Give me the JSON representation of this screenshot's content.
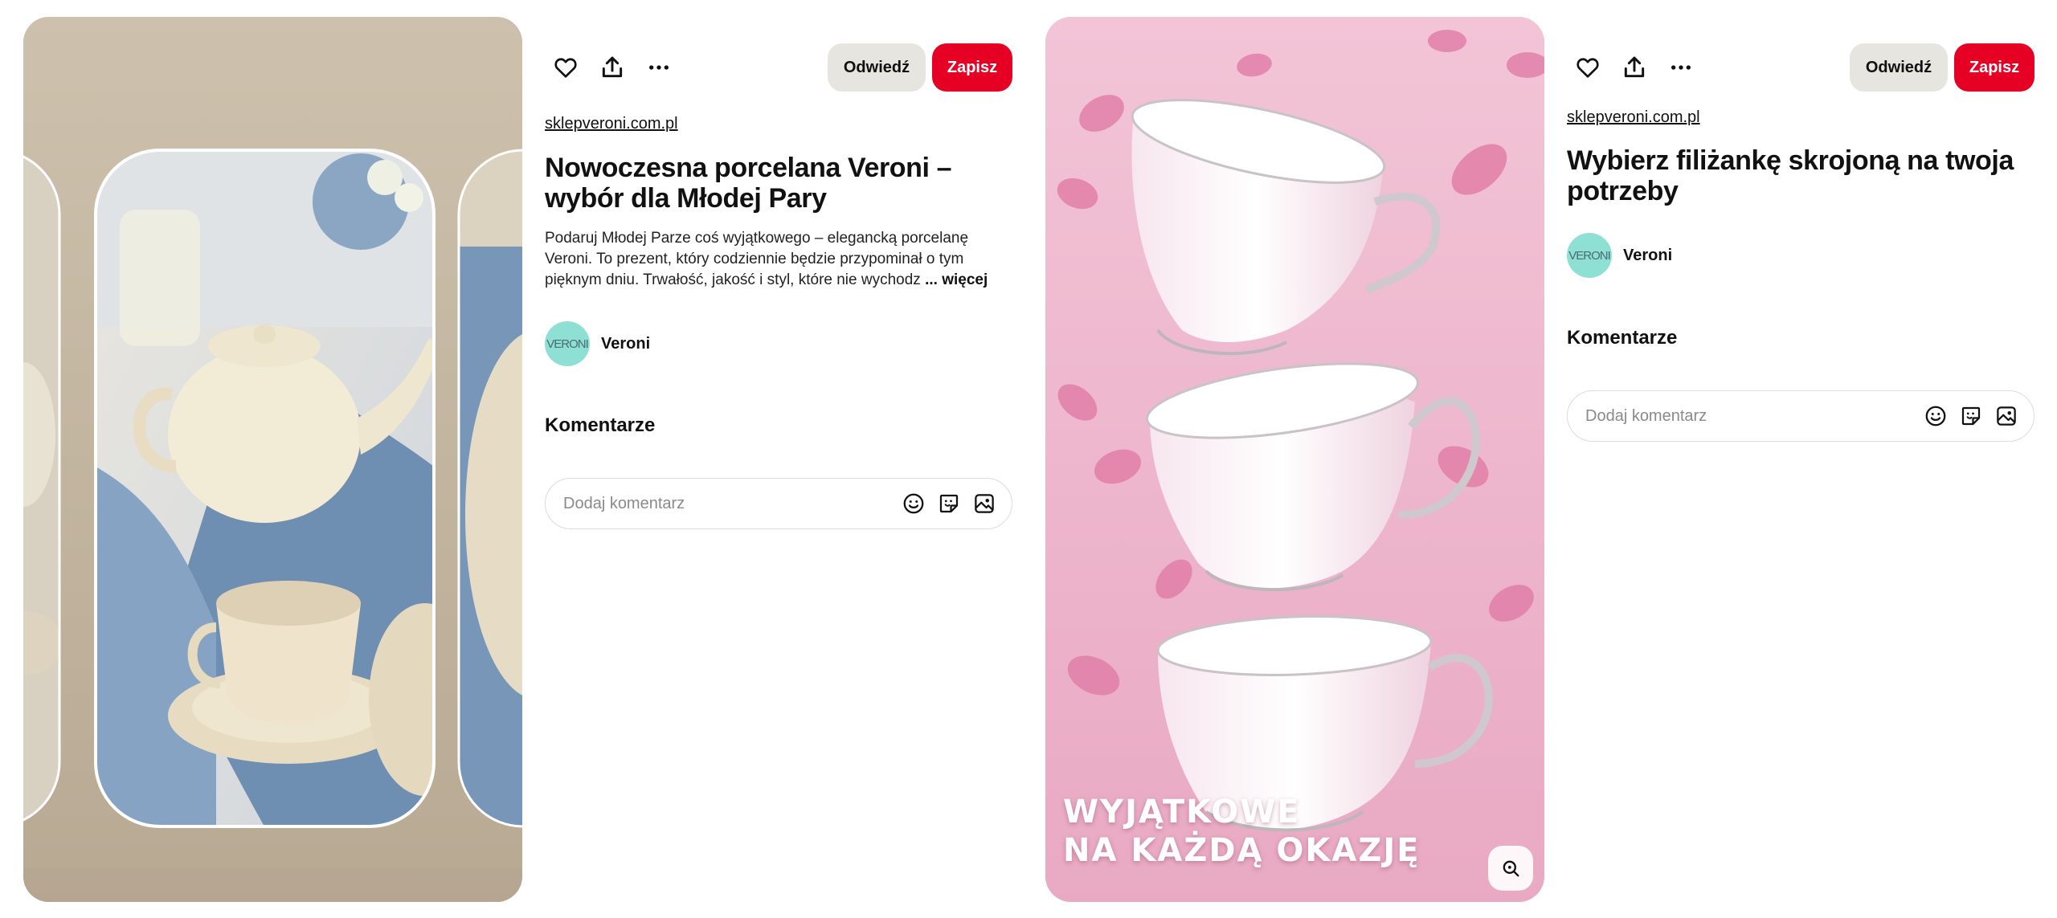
{
  "pins": [
    {
      "source": "sklepveroni.com.pl",
      "title": "Nowoczesna porcelana Veroni – wybór dla Młodej Pary",
      "description": "Podaruj Młodej Parze coś wyjątkowego – elegancką porcelanę Veroni. To prezent, który codziennie będzie przypominał o tym pięknym dniu. Trwałość, jakość i styl, które nie wychodz",
      "more": "... więcej",
      "author": "Veroni",
      "avatar_text": "VERONI",
      "visit_label": "Odwiedź",
      "save_label": "Zapisz",
      "comments_heading": "Komentarze",
      "comment_placeholder": "Dodaj komentarz",
      "media": "Porcelain tea set on table (carousel)"
    },
    {
      "source": "sklepveroni.com.pl",
      "title": "Wybierz filiżankę skrojoną na twoja potrzeby",
      "author": "Veroni",
      "avatar_text": "VERONI",
      "visit_label": "Odwiedź",
      "save_label": "Zapisz",
      "comments_heading": "Komentarze",
      "comment_placeholder": "Dodaj komentarz",
      "overlay_line1": "WYJĄTKOWE",
      "overlay_line2": "NA KAŻDĄ OKAZJĘ",
      "media": "Three white porcelain cups on pink background with petals"
    }
  ],
  "icons": [
    "heart-icon",
    "share-icon",
    "more-icon",
    "emoji-icon",
    "sticker-icon",
    "image-icon",
    "visual-search-icon"
  ],
  "colors": {
    "save": "#e60023",
    "visit": "#e6e5df",
    "avatar": "#8fe0d4",
    "pink_bg": "#efb9cf",
    "beige_bg": "#c9bca6"
  }
}
